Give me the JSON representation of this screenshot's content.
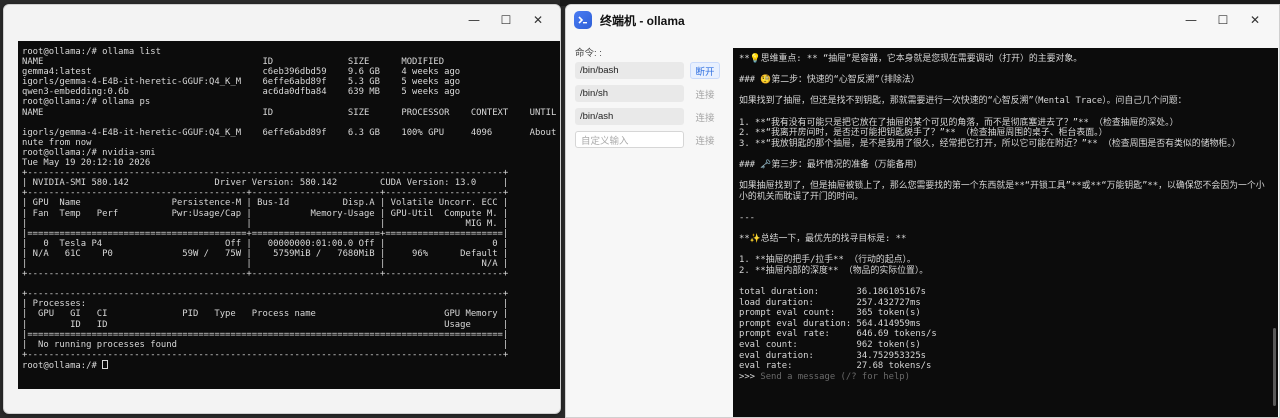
{
  "left_window": {
    "controls": {
      "minimize": "—",
      "maximize": "☐",
      "close": "✕"
    },
    "terminal_lines": [
      "root@ollama:/# ollama list",
      "NAME                                         ID              SIZE      MODIFIED",
      "gemma4:latest                                c6eb396dbd59    9.6 GB    4 weeks ago",
      "igorls/gemma-4-E4B-it-heretic-GGUF:Q4_K_M    6effe6abd89f    5.3 GB    5 weeks ago",
      "qwen3-embedding:0.6b                         ac6da0dfba84    639 MB    5 weeks ago",
      "root@ollama:/# ollama ps",
      "NAME                                         ID              SIZE      PROCESSOR    CONTEXT    UNTIL",
      "",
      "igorls/gemma-4-E4B-it-heretic-GGUF:Q4_K_M    6effe6abd89f    6.3 GB    100% GPU     4096       About a mi",
      "nute from now",
      "root@ollama:/# nvidia-smi",
      "Tue May 19 20:12:10 2026",
      "+-----------------------------------------------------------------------------------------+",
      "| NVIDIA-SMI 580.142                Driver Version: 580.142        CUDA Version: 13.0     |",
      "+-----------------------------------------+------------------------+----------------------+",
      "| GPU  Name                 Persistence-M | Bus-Id          Disp.A | Volatile Uncorr. ECC |",
      "| Fan  Temp   Perf          Pwr:Usage/Cap |           Memory-Usage | GPU-Util  Compute M. |",
      "|                                         |                        |               MIG M. |",
      "|=========================================+========================+======================|",
      "|   0  Tesla P4                       Off |   00000000:01:00.0 Off |                    0 |",
      "| N/A   61C    P0             59W /   75W |    5759MiB /   7680MiB |     96%      Default |",
      "|                                         |                        |                  N/A |",
      "+-----------------------------------------+------------------------+----------------------+",
      "",
      "+-----------------------------------------------------------------------------------------+",
      "| Processes:                                                                              |",
      "|  GPU   GI   CI              PID   Type   Process name                        GPU Memory |",
      "|        ID   ID                                                               Usage      |",
      "|=========================================================================================|",
      "|  No running processes found                                                             |",
      "+-----------------------------------------------------------------------------------------+"
    ],
    "final_prompt": "root@ollama:/# "
  },
  "right_window": {
    "title": "终端机 - ollama",
    "controls": {
      "minimize": "—",
      "maximize": "☐",
      "close": "✕"
    },
    "command_label": "命令: :",
    "shells": [
      {
        "path": "/bin/bash",
        "button": "断开",
        "active": true
      },
      {
        "path": "/bin/sh",
        "button": "连接",
        "active": false
      },
      {
        "path": "/bin/ash",
        "button": "连接",
        "active": false
      }
    ],
    "custom_input_placeholder": "自定义输入",
    "custom_button": "连接",
    "terminal_blocks": [
      "**💡思维重点: ** “抽屉”是容器，它本身就是您现在需要调动（打开）的主要对象。",
      "",
      "### 🧐第二步：快速的“心智反溯”（排除法）",
      "",
      "如果找到了抽屉，但还是找不到钥匙，那就需要进行一次快速的“心智反溯”（Mental Trace）。问自己几个问题：",
      "",
      "1. **“我有没有可能只是把它放在了抽屉的某个可见的角落，而不是彻底塞进去了？”** （检查抽屉的深处。）",
      "2. **“我离开房间时，是否还可能把钥匙脱手了？”** （检查抽屉周围的桌子、柜台表面。）",
      "3. **“我放钥匙的那个抽屉，是不是我用了很久，经常把它打开，所以它可能在附近？”** （检查周围是否有类似的储物柜。）",
      "",
      "### 🗝️第三步：最坏情况的准备（万能备用）",
      "",
      "如果抽屉找到了，但是抽屉被锁上了，那么您需要找的第一个东西就是**“开锁工具”**或**“万能钥匙”**，以确保您不会因为一个小小的机关而耽误了开门的时间。",
      "",
      "---",
      "",
      "**✨总结一下，最优先的找寻目标是: **",
      "",
      "1. **抽屉的把手/拉手** （行动的起点）。",
      "2. **抽屉内部的深度** （物品的实际位置）。",
      ""
    ],
    "stats": [
      "total duration:       36.186105167s",
      "load duration:        257.432727ms",
      "prompt eval count:    365 token(s)",
      "prompt eval duration: 564.414959ms",
      "prompt eval rate:     646.69 tokens/s",
      "eval count:           962 token(s)",
      "eval duration:        34.752953325s",
      "eval rate:            27.68 tokens/s"
    ],
    "input_prompt": ">>> ",
    "input_placeholder": "Send a message (/? for help)"
  },
  "colors": {
    "terminal_bg": "#0c0c0c",
    "terminal_fg": "#d8d8d8",
    "accent": "#2f6fe0"
  }
}
